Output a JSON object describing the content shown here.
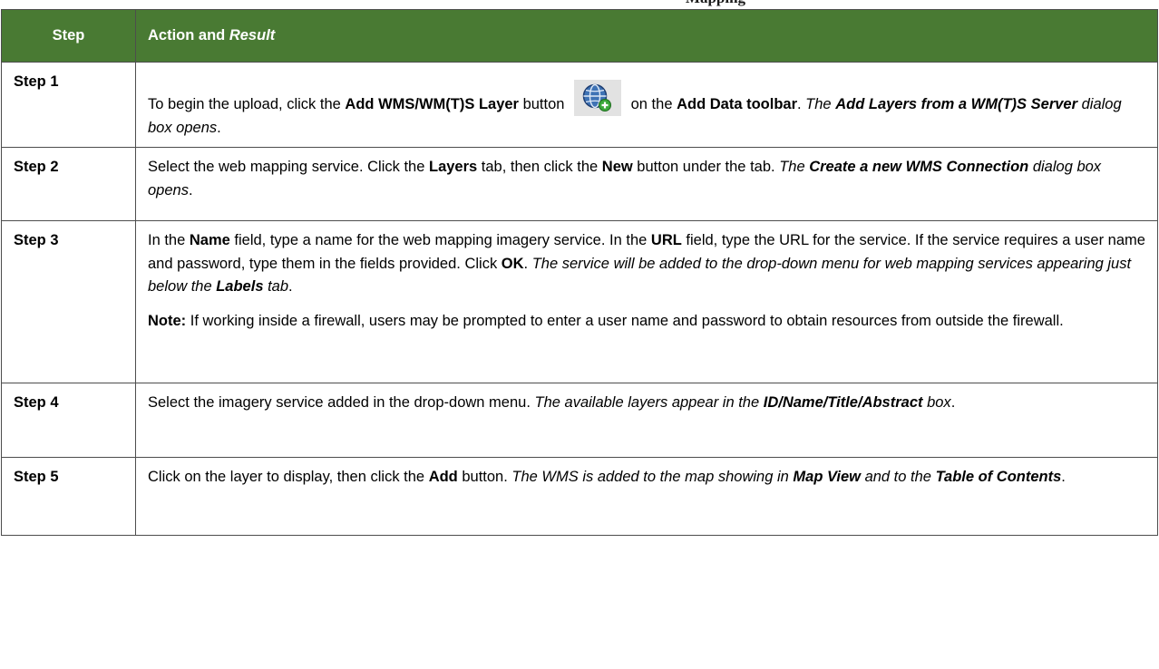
{
  "caption": "Mapping",
  "table": {
    "header": {
      "step": "Step",
      "action": [
        {
          "t": "Action and "
        },
        {
          "t": "Result",
          "s": "i"
        }
      ]
    },
    "rows": [
      {
        "label": "Step 1",
        "paragraphs": [
          [
            {
              "t": "To begin the upload, click the "
            },
            {
              "t": "Add WMS/WM(T)S Layer",
              "s": "b"
            },
            {
              "t": " button "
            },
            {
              "icon": "globe-add-icon"
            },
            {
              "t": " on the "
            },
            {
              "t": "Add Data toolbar",
              "s": "b"
            },
            {
              "t": ". "
            },
            {
              "t": "The ",
              "s": "i"
            },
            {
              "t": "Add Layers from a WM(T)S Server",
              "s": "bi"
            },
            {
              "t": " dialog box opens",
              "s": "i"
            },
            {
              "t": "."
            }
          ]
        ]
      },
      {
        "label": "Step 2",
        "paragraphs": [
          [
            {
              "t": "Select the web mapping service. Click the "
            },
            {
              "t": "Layers",
              "s": "b"
            },
            {
              "t": " tab, then click the "
            },
            {
              "t": "New",
              "s": "b"
            },
            {
              "t": " button under the tab. "
            },
            {
              "t": "The ",
              "s": "i"
            },
            {
              "t": "Create a new WMS Connection",
              "s": "bi"
            },
            {
              "t": " dialog box opens",
              "s": "i"
            },
            {
              "t": "."
            }
          ]
        ]
      },
      {
        "label": "Step 3",
        "paragraphs": [
          [
            {
              "t": "In the "
            },
            {
              "t": "Name",
              "s": "b"
            },
            {
              "t": " field, type a name for the web mapping imagery service. In the "
            },
            {
              "t": "URL",
              "s": "b"
            },
            {
              "t": " field, type the URL for the service. If the service requires a user name and password, type them in the fields provided. Click "
            },
            {
              "t": "OK",
              "s": "b"
            },
            {
              "t": ". "
            },
            {
              "t": "The service will be added to the drop-down menu for web mapping services appearing just below the ",
              "s": "i"
            },
            {
              "t": "Labels",
              "s": "bi"
            },
            {
              "t": " tab",
              "s": "i"
            },
            {
              "t": "."
            }
          ],
          [
            {
              "t": "Note:",
              "s": "b"
            },
            {
              "t": " If working inside a firewall, users may be prompted to enter a user name and password to obtain resources from outside the firewall."
            }
          ]
        ]
      },
      {
        "label": "Step 4",
        "paragraphs": [
          [
            {
              "t": "Select the imagery service added in the drop-down menu. "
            },
            {
              "t": "The available layers appear in the ",
              "s": "i"
            },
            {
              "t": "ID/Name/Title/Abstract",
              "s": "bi"
            },
            {
              "t": " box",
              "s": "i"
            },
            {
              "t": "."
            }
          ]
        ]
      },
      {
        "label": "Step 5",
        "paragraphs": [
          [
            {
              "t": "Click on the layer to display, then click the "
            },
            {
              "t": "Add",
              "s": "b"
            },
            {
              "t": " button. "
            },
            {
              "t": "The WMS is added to the map showing in ",
              "s": "i"
            },
            {
              "t": "Map View",
              "s": "bi"
            },
            {
              "t": " and to the ",
              "s": "i"
            },
            {
              "t": "Table of Contents",
              "s": "bi"
            },
            {
              "t": "."
            }
          ]
        ]
      }
    ]
  }
}
